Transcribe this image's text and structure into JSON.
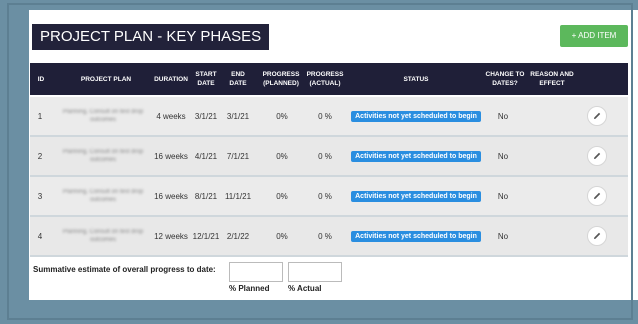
{
  "title": "PROJECT PLAN - KEY PHASES",
  "add_button": "+ ADD ITEM",
  "headers": {
    "id": "ID",
    "plan": "PROJECT PLAN",
    "duration": "DURATION",
    "start": "START DATE",
    "end": "END DATE",
    "planned": "PROGRESS (PLANNED)",
    "actual": "PROGRESS (ACTUAL)",
    "status": "STATUS",
    "change": "CHANGE TO DATES?",
    "reason": "REASON AND EFFECT"
  },
  "rows": [
    {
      "id": "1",
      "plan": "Planning, Consult on test drop outcomes",
      "duration": "4 weeks",
      "start": "3/1/21",
      "end": "3/1/21",
      "planned": "0%",
      "actual": "0 %",
      "status": "Activities not yet scheduled to begin",
      "change": "No"
    },
    {
      "id": "2",
      "plan": "Planning, Consult on test drop outcomes",
      "duration": "16 weeks",
      "start": "4/1/21",
      "end": "7/1/21",
      "planned": "0%",
      "actual": "0 %",
      "status": "Activities not yet scheduled to begin",
      "change": "No"
    },
    {
      "id": "3",
      "plan": "Planning, Consult on test drop outcomes",
      "duration": "16 weeks",
      "start": "8/1/21",
      "end": "11/1/21",
      "planned": "0%",
      "actual": "0 %",
      "status": "Activities not yet scheduled to begin",
      "change": "No"
    },
    {
      "id": "4",
      "plan": "Planning, Consult on test drop outcomes",
      "duration": "12 weeks",
      "start": "12/1/21",
      "end": "2/1/22",
      "planned": "0%",
      "actual": "0 %",
      "status": "Activities not yet scheduled to begin",
      "change": "No"
    }
  ],
  "summary": {
    "label": "Summative estimate of overall progress to date:",
    "planned_label": "% Planned",
    "actual_label": "% Actual",
    "planned_value": "",
    "actual_value": ""
  }
}
